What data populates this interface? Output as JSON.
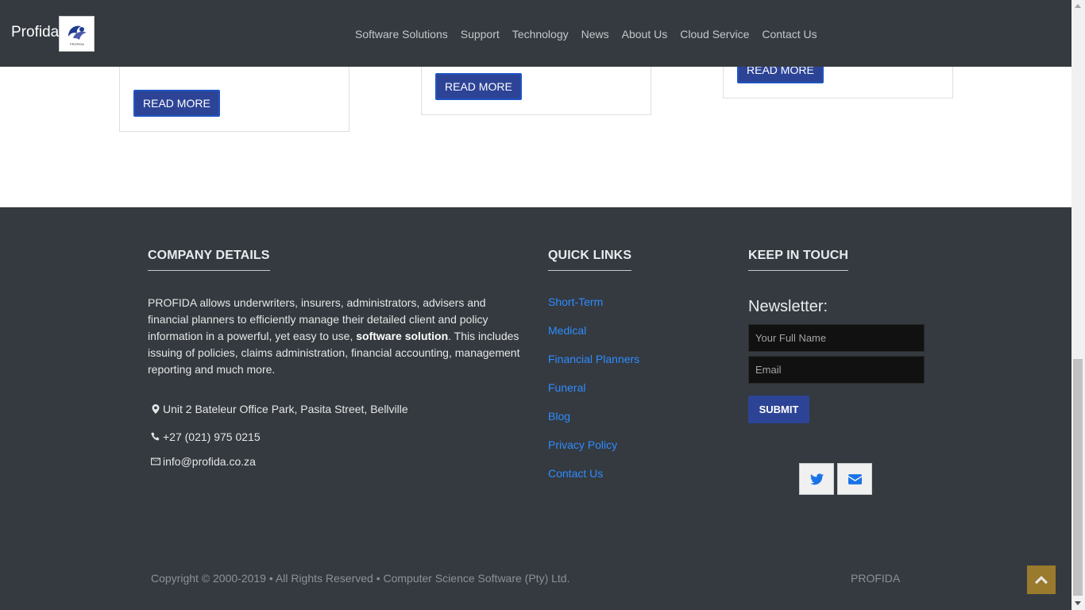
{
  "navbar": {
    "brand": "Profida",
    "logo_text": "PROFIDA",
    "links": [
      "Software Solutions",
      "Support",
      "Technology",
      "News",
      "About Us",
      "Cloud Service",
      "Contact Us"
    ]
  },
  "cards": {
    "read_more_label": "READ MORE"
  },
  "footer": {
    "company": {
      "heading": "COMPANY DETAILS",
      "text_before": "PROFIDA allows underwriters, insurers, administrators, advisers and financial planners to efficiently manage their detailed client and policy information in a powerful, yet easy to use, ",
      "text_bold": "software solution",
      "text_after": ". This includes issuing of policies, claims administration, financial accounting, management reporting and much more.",
      "address": "Unit 2 Bateleur Office Park, Pasita Street, Bellville",
      "phone": "+27 (021) 975 0215",
      "email": "info@profida.co.za"
    },
    "quick_links": {
      "heading": "QUICK LINKS",
      "items": [
        "Short-Term",
        "Medical",
        "Financial Planners",
        "Funeral",
        "Blog",
        "Privacy Policy",
        "Contact Us"
      ]
    },
    "keep_in_touch": {
      "heading": "KEEP IN TOUCH",
      "newsletter_title": "Newsletter:",
      "name_placeholder": "Your Full Name",
      "email_placeholder": "Email",
      "submit_label": "SUBMIT"
    },
    "copyright": "Copyright © 2000-2019 • All Rights Reserved • Computer Science Software (Pty) Ltd.",
    "brand": "PROFIDA"
  },
  "colors": {
    "dark_bg": "#343a40",
    "button_blue": "#2d4496",
    "link_blue": "#2f8bff",
    "back_to_top": "#9a7a2c"
  },
  "icons": {
    "address": "map-marker-icon",
    "phone": "phone-icon",
    "email": "envelope-icon",
    "social": [
      "twitter-icon",
      "envelope-icon"
    ],
    "back_to_top": "chevron-up-icon"
  }
}
